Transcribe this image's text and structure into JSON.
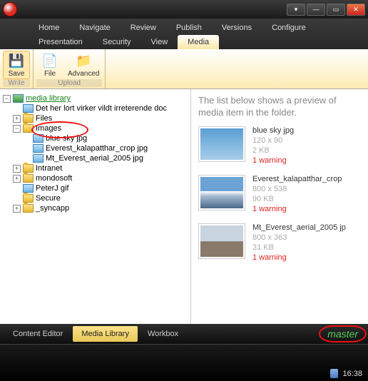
{
  "menu": {
    "items": [
      "Home",
      "Navigate",
      "Review",
      "Publish",
      "Versions",
      "Configure",
      "Presentation",
      "Security",
      "View",
      "Media"
    ],
    "active": "Media"
  },
  "ribbon": {
    "write": {
      "group": "Write",
      "save": "Save"
    },
    "upload": {
      "group": "Upload",
      "file": "File",
      "advanced": "Advanced"
    }
  },
  "tree": {
    "root": "media library",
    "nodes": [
      {
        "indent": 1,
        "exp": "",
        "icon": "pic",
        "label": "Det her lort virker vildt irreterende doc"
      },
      {
        "indent": 1,
        "exp": "+",
        "icon": "fold",
        "label": "Files"
      },
      {
        "indent": 1,
        "exp": "-",
        "icon": "fold",
        "label": "Images",
        "circled": true
      },
      {
        "indent": 2,
        "exp": "",
        "icon": "pic",
        "label": "blue sky jpg"
      },
      {
        "indent": 2,
        "exp": "",
        "icon": "pic",
        "label": "Everest_kalapatthar_crop jpg"
      },
      {
        "indent": 2,
        "exp": "",
        "icon": "pic",
        "label": "Mt_Everest_aerial_2005 jpg"
      },
      {
        "indent": 1,
        "exp": "+",
        "icon": "fold",
        "label": "Intranet"
      },
      {
        "indent": 1,
        "exp": "+",
        "icon": "fold",
        "label": "mondosoft"
      },
      {
        "indent": 1,
        "exp": "",
        "icon": "pic",
        "label": "PeterJ gif"
      },
      {
        "indent": 1,
        "exp": "",
        "icon": "fold",
        "label": "Secure"
      },
      {
        "indent": 1,
        "exp": "+",
        "icon": "fold",
        "label": "_syncapp"
      }
    ]
  },
  "preview": {
    "heading": "The list below shows a preview of media item in the folder.",
    "items": [
      {
        "thumb": "sky",
        "name": "blue sky jpg",
        "dim": "120 x 90",
        "size": "2 KB",
        "warn": "1 warning"
      },
      {
        "thumb": "mtn1",
        "name": "Everest_kalapatthar_crop",
        "dim": "800 x 538",
        "size": "90 KB",
        "warn": "1 warning"
      },
      {
        "thumb": "mtn2",
        "name": "Mt_Everest_aerial_2005 jp",
        "dim": "800 x 363",
        "size": "31 KB",
        "warn": "1 warning"
      }
    ]
  },
  "bottom": {
    "tabs": [
      "Content Editor",
      "Media Library",
      "Workbox"
    ],
    "active": "Media Library",
    "master": "master"
  },
  "status": {
    "time": "16:38"
  }
}
